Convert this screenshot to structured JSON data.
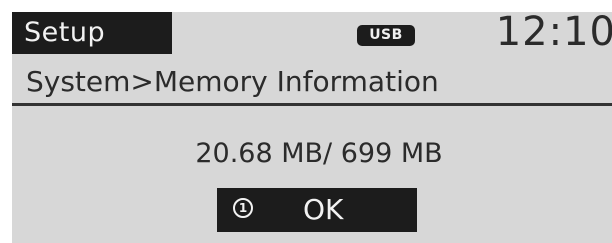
{
  "header": {
    "tab_label": "Setup",
    "usb_label": "USB",
    "clock": "12:10"
  },
  "breadcrumb": "System>Memory Information",
  "memory": {
    "used_total": "20.68 MB/ 699 MB"
  },
  "ok_button": {
    "number": "1",
    "label": "OK"
  }
}
